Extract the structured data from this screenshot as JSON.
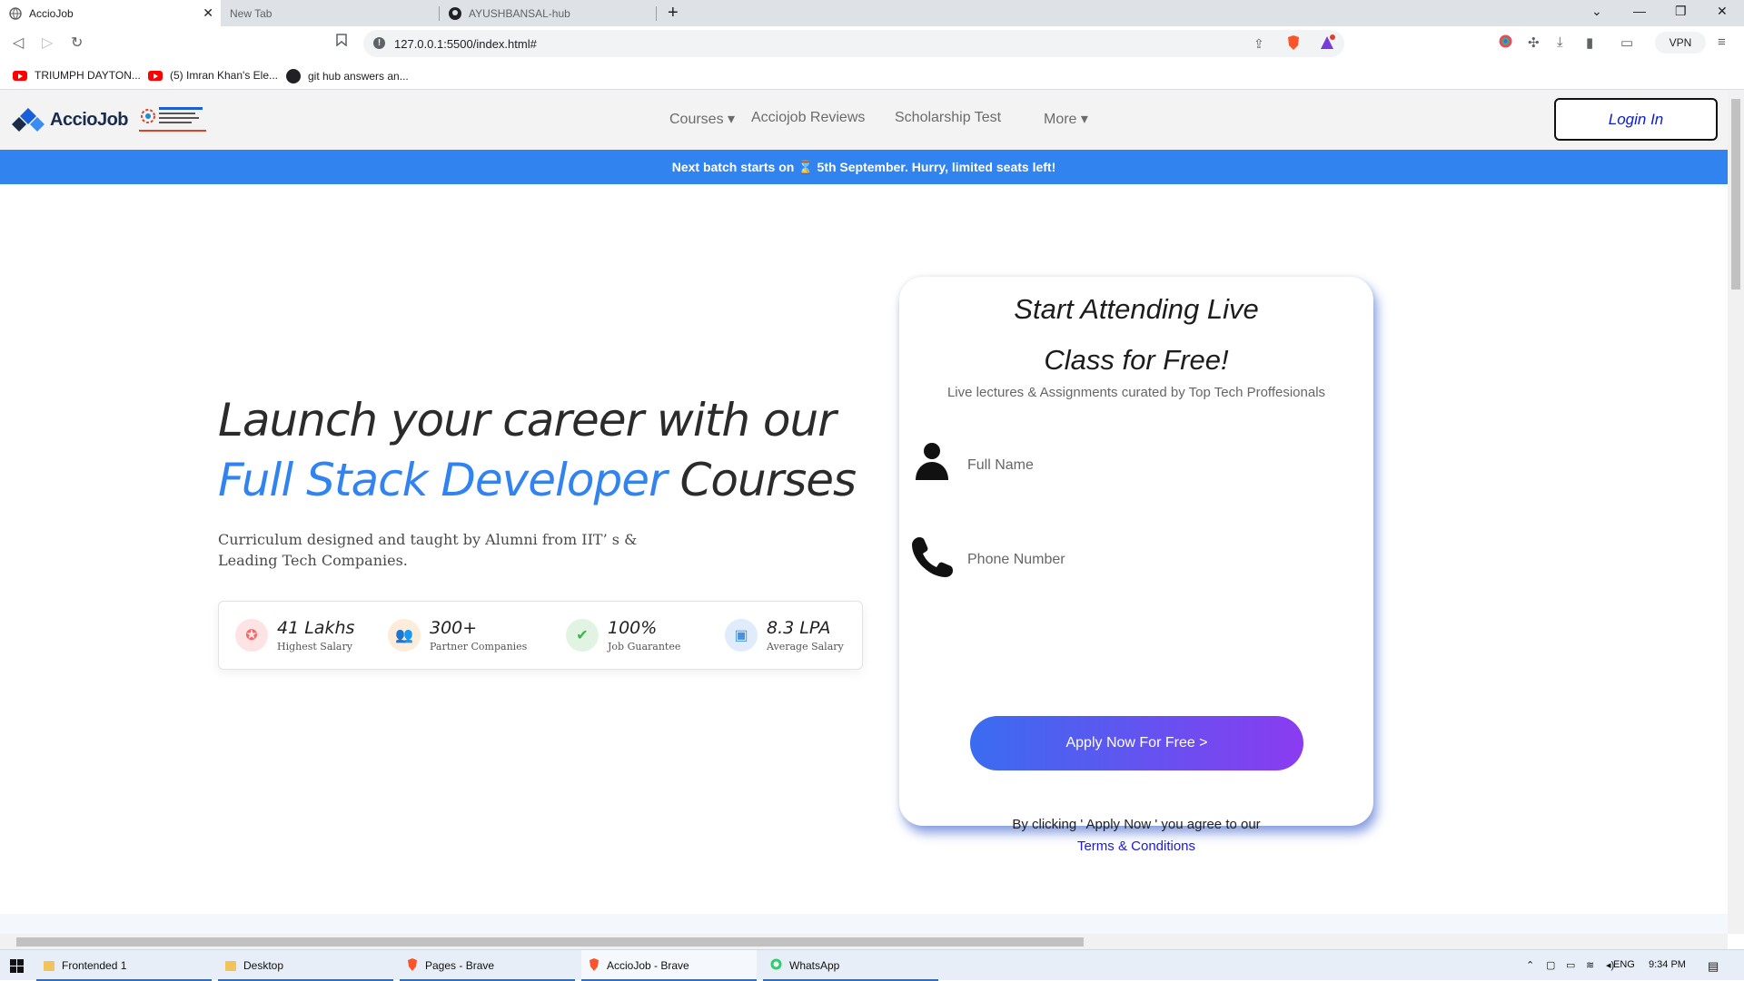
{
  "browser": {
    "tabs": [
      {
        "title": "AccioJob",
        "active": true
      },
      {
        "title": "New Tab",
        "active": false
      },
      {
        "title": "AYUSHBANSAL-hub",
        "active": false
      }
    ],
    "url": "127.0.0.1:5500/index.html#",
    "vpn_label": "VPN",
    "bookmarks": [
      {
        "label": "TRIUMPH DAYTON...",
        "icon": "youtube-icon"
      },
      {
        "label": "(5) Imran Khan's Ele...",
        "icon": "youtube-icon"
      },
      {
        "label": "git hub answers an...",
        "icon": "github-icon"
      }
    ]
  },
  "site": {
    "logo_text": "AccioJob",
    "nav": {
      "courses": "Courses",
      "reviews": "Acciojob Reviews",
      "scholarship": "Scholarship Test",
      "more": "More"
    },
    "login_label": "Login In",
    "banner": "Next batch starts on ⌛ 5th September. Hurry, limited seats left!",
    "hero": {
      "line1": "Launch your career with our",
      "accent": "Full Stack Developer",
      "line2_rest": " Courses",
      "subtitle": "Curriculum designed and taught by Alumni from IIT’ s & Leading Tech Companies."
    },
    "stats": [
      {
        "value": "41 Lakhs",
        "label": "Highest Salary",
        "icon": "medal-icon",
        "color": "#f06a6a"
      },
      {
        "value": "300+",
        "label": "Partner Companies",
        "icon": "people-icon",
        "color": "#f5a04a"
      },
      {
        "value": "100%",
        "label": "Job Guarantee",
        "icon": "shield-check-icon",
        "color": "#3ab54a"
      },
      {
        "value": "8.3 LPA",
        "label": "Average Salary",
        "icon": "wallet-icon",
        "color": "#4a90e2"
      }
    ],
    "form": {
      "title_line1": "Start Attending Live",
      "title_line2": "Class for Free!",
      "subtitle": "Live lectures & Assignments curated by Top Tech Proffesionals",
      "name_placeholder": "Full Name",
      "phone_placeholder": "Phone Number",
      "apply_label": "Apply Now For Free >",
      "agree_text": "By clicking ' Apply Now ' you agree to our",
      "terms_label": "Terms & Conditions"
    }
  },
  "taskbar": {
    "items": [
      {
        "label": "Frontended 1"
      },
      {
        "label": "Desktop"
      },
      {
        "label": "Pages - Brave"
      },
      {
        "label": "AccioJob - Brave"
      },
      {
        "label": "WhatsApp"
      }
    ],
    "lang": "ENG",
    "time": "9:34 PM"
  },
  "colors": {
    "accent": "#3184f0",
    "banner": "#3184f0",
    "login_text": "#0a1bd8"
  }
}
